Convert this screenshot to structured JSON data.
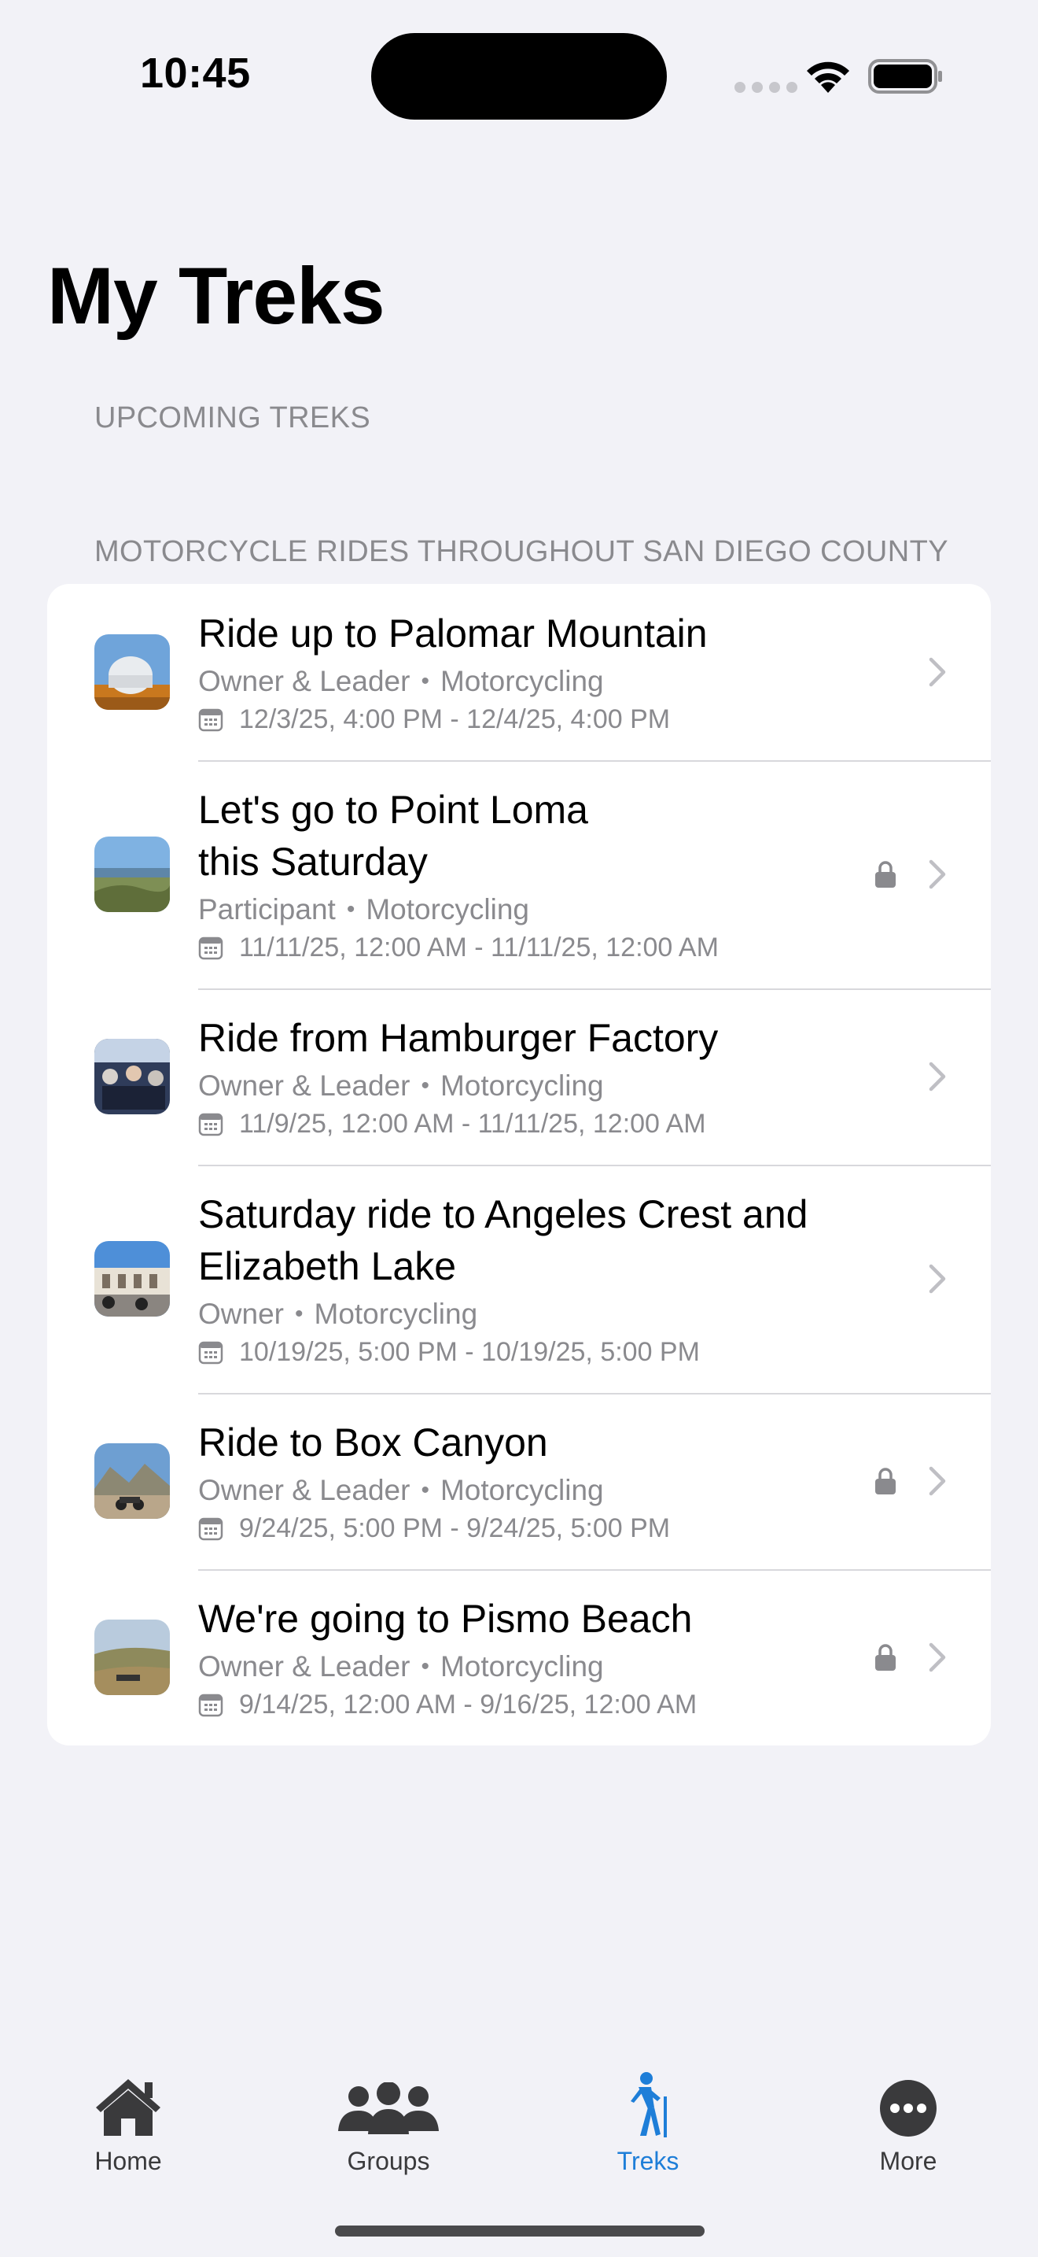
{
  "status_bar": {
    "time": "10:45"
  },
  "title": "My Treks",
  "sections": {
    "upcoming": "UPCOMING TREKS",
    "group": "MOTORCYCLE RIDES THROUGHOUT SAN DIEGO COUNTY"
  },
  "treks": [
    {
      "title": "Ride up to Palomar Mountain",
      "role": "Owner & Leader",
      "activity": "Motorcycling",
      "dates": "12/3/25, 4:00 PM - 12/4/25, 4:00 PM",
      "locked": false,
      "thumb": "observatory"
    },
    {
      "title": "Let's go to Point Loma this Saturday",
      "role": "Participant",
      "activity": "Motorcycling",
      "dates": "11/11/25, 12:00 AM - 11/11/25, 12:00 AM",
      "locked": true,
      "thumb": "coast"
    },
    {
      "title": "Ride from Hamburger Factory",
      "role": "Owner & Leader",
      "activity": "Motorcycling",
      "dates": "11/9/25, 12:00 AM - 11/11/25, 12:00 AM",
      "locked": false,
      "thumb": "riders"
    },
    {
      "title": "Saturday ride to Angeles Crest and Elizabeth Lake",
      "role": "Owner",
      "activity": "Motorcycling",
      "dates": "10/19/25, 5:00 PM - 10/19/25, 5:00 PM",
      "locked": false,
      "thumb": "building"
    },
    {
      "title": "Ride to Box Canyon",
      "role": "Owner & Leader",
      "activity": "Motorcycling",
      "dates": "9/24/25, 5:00 PM - 9/24/25, 5:00 PM",
      "locked": true,
      "thumb": "canyon"
    },
    {
      "title": "We're going to Pismo Beach",
      "role": "Owner & Leader",
      "activity": "Motorcycling",
      "dates": "9/14/25, 12:00 AM - 9/16/25, 12:00 AM",
      "locked": true,
      "thumb": "hills"
    }
  ],
  "tabbar": {
    "home": "Home",
    "groups": "Groups",
    "treks": "Treks",
    "more": "More",
    "active": "treks"
  },
  "colors": {
    "accent": "#1E7ED8",
    "secondary_text": "#8A8A8E",
    "background": "#F2F2F7"
  }
}
